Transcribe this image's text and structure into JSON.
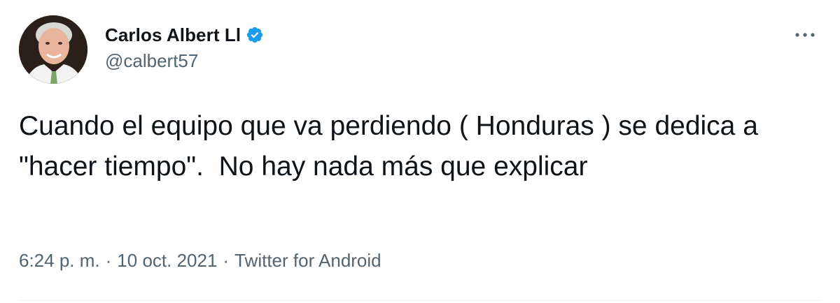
{
  "author": {
    "display_name": "Carlos Albert Ll",
    "handle": "@calbert57",
    "verified": true,
    "avatar_icon": "profile-photo"
  },
  "menu": {
    "more_icon": "more-horizontal-icon"
  },
  "tweet": {
    "text": "Cuando el equipo que va perdiendo ( Honduras ) se dedica a \"hacer tiempo\".  No hay nada más que explicar"
  },
  "meta": {
    "time": "6:24 p. m.",
    "date": "10 oct. 2021",
    "separator": "·",
    "source": "Twitter for Android"
  },
  "colors": {
    "text_primary": "#0f1419",
    "text_secondary": "#536471",
    "verified_blue": "#1d9bf0",
    "divider": "#eff3f4"
  }
}
